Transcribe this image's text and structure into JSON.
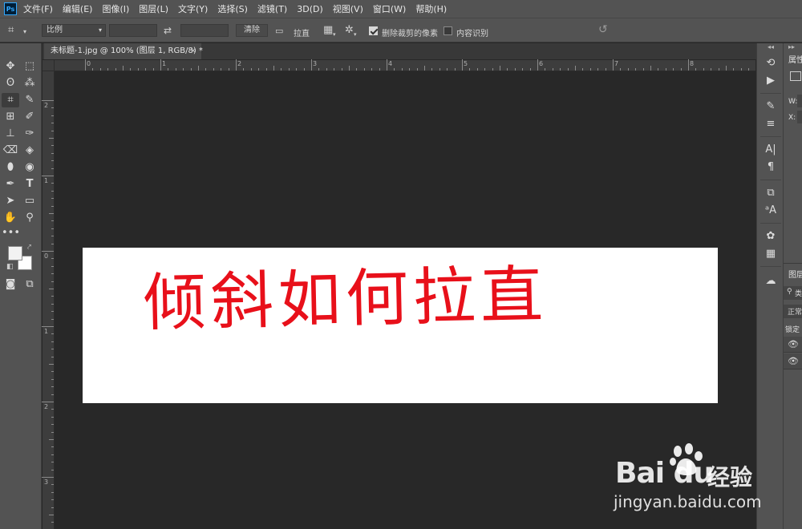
{
  "app": {
    "logo": "Ps"
  },
  "menu": [
    "文件(F)",
    "编辑(E)",
    "图像(I)",
    "图层(L)",
    "文字(Y)",
    "选择(S)",
    "滤镜(T)",
    "3D(D)",
    "视图(V)",
    "窗口(W)",
    "帮助(H)"
  ],
  "options": {
    "ratio_value": "比例",
    "width_value": "",
    "height_value": "",
    "clear_label": "清除",
    "straighten_label": "拉直",
    "delete_cropped_label": "删除裁剪的像素",
    "delete_cropped_checked": true,
    "content_aware_label": "内容识别",
    "content_aware_checked": false
  },
  "document": {
    "tab_title": "未标题-1.jpg @ 100% (图层 1, RGB/8) *",
    "tab_close": "×",
    "canvas_text": "倾斜如何拉直"
  },
  "rulers": {
    "top_labels": [
      "0",
      "1",
      "2",
      "3",
      "4",
      "5",
      "6",
      "7",
      "8"
    ],
    "left_labels": [
      "2",
      "1",
      "0",
      "1",
      "2",
      "3"
    ]
  },
  "panels": {
    "properties_title": "属性",
    "properties_w": "W:",
    "properties_x": "X:",
    "layers_title": "图层",
    "layers_kind": "类",
    "layers_mode": "正常",
    "layers_lock": "锁定"
  },
  "watermark": {
    "logo_text": "Bai du",
    "brand": "经验",
    "url": "jingyan.baidu.com"
  },
  "colors": {
    "canvas_text": "#e8101a",
    "ui_panel": "#535353",
    "pasteboard": "#282828"
  }
}
